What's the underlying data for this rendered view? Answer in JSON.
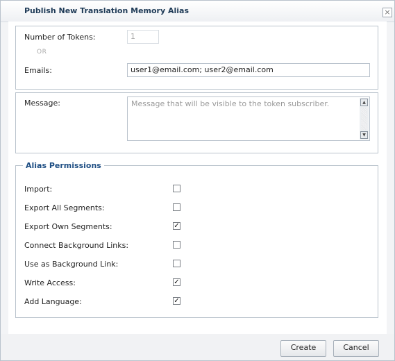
{
  "dialog": {
    "title": "Publish New Translation Memory Alias",
    "close_glyph": "×"
  },
  "tokens": {
    "number_label": "Number of Tokens:",
    "number_value": "1",
    "or_label": "OR",
    "emails_label": "Emails:",
    "emails_value": "user1@email.com; user2@email.com"
  },
  "message": {
    "label": "Message:",
    "placeholder": "Message that will be visible to the token subscriber."
  },
  "permissions": {
    "legend": "Alias Permissions",
    "items": [
      {
        "label": "Import:",
        "checked": false
      },
      {
        "label": "Export All Segments:",
        "checked": false
      },
      {
        "label": "Export Own Segments:",
        "checked": true
      },
      {
        "label": "Connect Background Links:",
        "checked": false
      },
      {
        "label": "Use as Background Link:",
        "checked": false
      },
      {
        "label": "Write Access:",
        "checked": true
      },
      {
        "label": "Add Language:",
        "checked": true
      }
    ]
  },
  "buttons": {
    "create": "Create",
    "cancel": "Cancel"
  },
  "colors": {
    "title_text": "#1f3b57",
    "legend_text": "#1f4f84",
    "border": "#b9c2cc"
  }
}
